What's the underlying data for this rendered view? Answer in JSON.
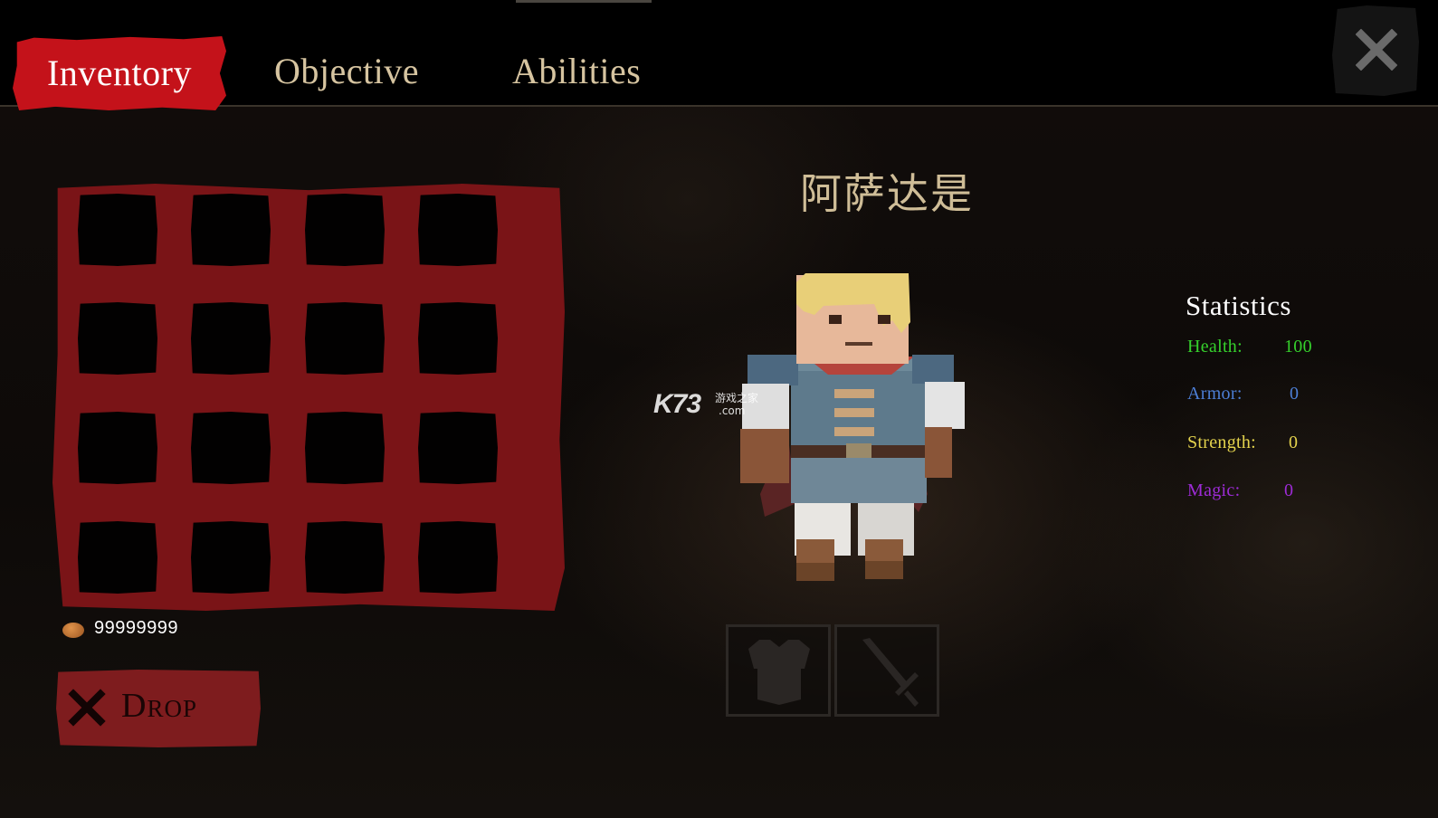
{
  "tabs": {
    "inventory": "Inventory",
    "objective": "Objective",
    "abilities": "Abilities",
    "active": "Inventory"
  },
  "close_icon": "close-icon",
  "inventory": {
    "slot_rows": 4,
    "slot_cols": 4,
    "gold": "99999999",
    "coin_icon": "coin-icon",
    "drop_label": "Drop"
  },
  "character": {
    "name": "阿萨达是"
  },
  "watermark": {
    "brand": "K73",
    "sub_line1": "游戏之家",
    "sub_line2": ".com"
  },
  "equipment": {
    "armor_icon": "chest-armor-icon",
    "weapon_icon": "sword-icon"
  },
  "stats": {
    "title": "Statistics",
    "health_label": "Health:",
    "health_value": "100",
    "armor_label": "Armor:",
    "armor_value": "0",
    "strength_label": "Strength:",
    "strength_value": "0",
    "magic_label": "Magic:",
    "magic_value": "0"
  },
  "colors": {
    "active_tab": "#c4121a",
    "panel_red": "#7a1417",
    "tab_text": "#d6c4a0",
    "health": "#35d12c",
    "armor": "#4d7fd6",
    "strength": "#e4d34d",
    "magic": "#9d2bd6"
  }
}
